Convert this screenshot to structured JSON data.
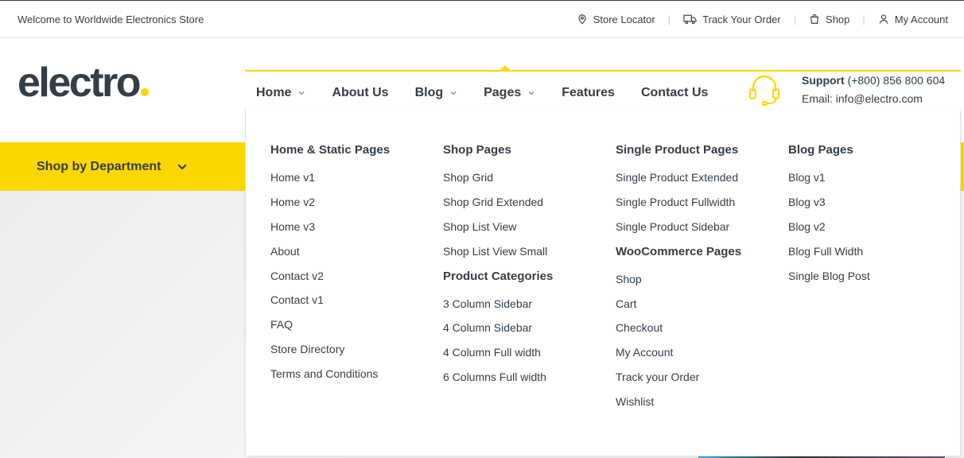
{
  "topbar": {
    "welcome": "Welcome to Worldwide Electronics Store",
    "links": [
      {
        "label": "Store Locator",
        "icon": "map-pin-icon"
      },
      {
        "label": "Track Your Order",
        "icon": "truck-icon"
      },
      {
        "label": "Shop",
        "icon": "shopping-bag-icon"
      },
      {
        "label": "My Account",
        "icon": "user-icon"
      }
    ]
  },
  "logo": {
    "text": "electro",
    "dot_color": "#fed700"
  },
  "nav": {
    "items": [
      {
        "label": "Home",
        "has_dropdown": true
      },
      {
        "label": "About Us",
        "has_dropdown": false
      },
      {
        "label": "Blog",
        "has_dropdown": true
      },
      {
        "label": "Pages",
        "has_dropdown": true,
        "active": true
      },
      {
        "label": "Features",
        "has_dropdown": false
      },
      {
        "label": "Contact Us",
        "has_dropdown": false
      }
    ]
  },
  "support": {
    "label": "Support",
    "phone": "(+800) 856 800 604",
    "email": "Email: info@electro.com",
    "icon": "headset-icon"
  },
  "department": {
    "label": "Shop by Department",
    "icon": "chevron-down-icon"
  },
  "megamenu": {
    "columns": [
      {
        "groups": [
          {
            "heading": "Home & Static Pages",
            "links": [
              "Home v1",
              "Home v2",
              "Home v3",
              "About",
              "Contact v2",
              "Contact v1",
              "FAQ",
              "Store Directory",
              "Terms and Conditions"
            ]
          }
        ]
      },
      {
        "groups": [
          {
            "heading": "Shop Pages",
            "links": [
              "Shop Grid",
              "Shop Grid Extended",
              "Shop List View",
              "Shop List View Small"
            ]
          },
          {
            "heading": "Product Categories",
            "links": [
              "3 Column Sidebar",
              "4 Column Sidebar",
              "4 Column Full width",
              "6 Columns Full width"
            ]
          }
        ]
      },
      {
        "groups": [
          {
            "heading": "Single Product Pages",
            "links": [
              "Single Product Extended",
              "Single Product Fullwidth",
              "Single Product Sidebar"
            ]
          },
          {
            "heading": "WooCommerce Pages",
            "links": [
              "Shop",
              "Cart",
              "Checkout",
              "My Account",
              "Track your Order",
              "Wishlist"
            ]
          }
        ]
      },
      {
        "groups": [
          {
            "heading": "Blog Pages",
            "links": [
              "Blog v1",
              "Blog v3",
              "Blog v2",
              "Blog Full Width",
              "Single Blog Post"
            ]
          }
        ]
      }
    ]
  },
  "colors": {
    "accent": "#fed700",
    "text": "#333e48"
  }
}
